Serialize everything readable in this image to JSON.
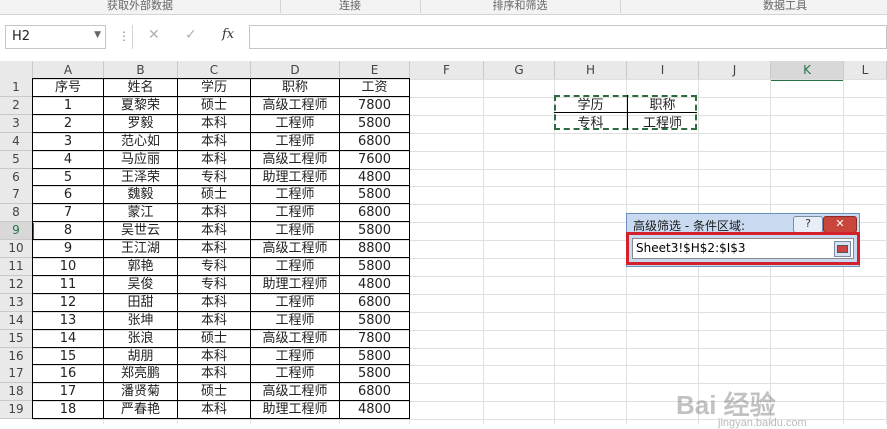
{
  "ribbon": {
    "groups": [
      "获取外部数据",
      "连接",
      "排序和筛选",
      "数据工具"
    ]
  },
  "formula_bar": {
    "name_box": "H2",
    "fx": "fx",
    "formula": ""
  },
  "columns": [
    "A",
    "B",
    "C",
    "D",
    "E",
    "F",
    "G",
    "H",
    "I",
    "J",
    "K",
    "L"
  ],
  "rows": [
    "1",
    "2",
    "3",
    "4",
    "5",
    "6",
    "7",
    "8",
    "9",
    "10",
    "11",
    "12",
    "13",
    "14",
    "15",
    "16",
    "17",
    "18",
    "19"
  ],
  "table": {
    "headers": [
      "序号",
      "姓名",
      "学历",
      "职称",
      "工资"
    ],
    "data": [
      [
        "1",
        "夏黎荣",
        "硕士",
        "高级工程师",
        "7800"
      ],
      [
        "2",
        "罗毅",
        "本科",
        "工程师",
        "5800"
      ],
      [
        "3",
        "范心如",
        "本科",
        "工程师",
        "6800"
      ],
      [
        "4",
        "马应丽",
        "本科",
        "高级工程师",
        "7600"
      ],
      [
        "5",
        "王泽荣",
        "专科",
        "助理工程师",
        "4800"
      ],
      [
        "6",
        "魏毅",
        "硕士",
        "工程师",
        "5800"
      ],
      [
        "7",
        "蒙江",
        "本科",
        "工程师",
        "6800"
      ],
      [
        "8",
        "吴世云",
        "本科",
        "工程师",
        "5800"
      ],
      [
        "9",
        "王江湖",
        "本科",
        "高级工程师",
        "8800"
      ],
      [
        "10",
        "郭艳",
        "专科",
        "工程师",
        "5800"
      ],
      [
        "11",
        "吴俊",
        "专科",
        "助理工程师",
        "4800"
      ],
      [
        "12",
        "田甜",
        "本科",
        "工程师",
        "6800"
      ],
      [
        "13",
        "张坤",
        "本科",
        "工程师",
        "5800"
      ],
      [
        "14",
        "张浪",
        "硕士",
        "高级工程师",
        "7800"
      ],
      [
        "15",
        "胡朋",
        "本科",
        "工程师",
        "5800"
      ],
      [
        "16",
        "郑亮鹏",
        "本科",
        "工程师",
        "5800"
      ],
      [
        "17",
        "潘贤菊",
        "硕士",
        "高级工程师",
        "6800"
      ],
      [
        "18",
        "严春艳",
        "本科",
        "助理工程师",
        "4800"
      ]
    ]
  },
  "criteria": {
    "headers": [
      "学历",
      "职称"
    ],
    "values": [
      "专科",
      "工程师"
    ]
  },
  "dialog": {
    "title": "高级筛选 - 条件区域:",
    "help": "?",
    "close": "✕",
    "range_value": "Sheet3!$H$2:$I$3"
  },
  "watermark": {
    "brand": "Bai 经验",
    "url": "jingyan.baidu.com"
  }
}
